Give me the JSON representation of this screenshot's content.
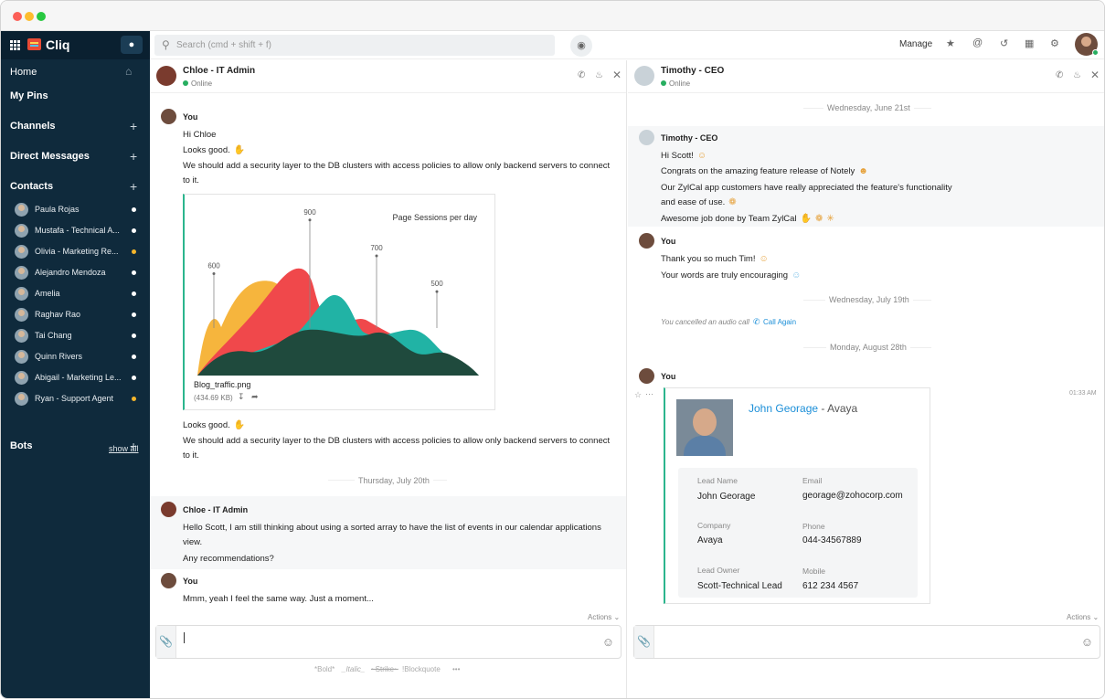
{
  "app": {
    "name": "Cliq"
  },
  "sidebar": {
    "home": "Home",
    "pins": "My Pins",
    "channels": "Channels",
    "direct": "Direct Messages",
    "contacts": "Contacts",
    "bots": "Bots",
    "show_all": "show all",
    "contact_list": [
      {
        "name": "Paula Rojas",
        "status_color": "#ffffff"
      },
      {
        "name": "Mustafa - Technical A...",
        "status_color": "#ffffff"
      },
      {
        "name": "Olivia - Marketing Re...",
        "status_color": "#f5b62b"
      },
      {
        "name": "Alejandro Mendoza",
        "status_color": "#ffffff"
      },
      {
        "name": "Amelia",
        "status_color": "#ffffff"
      },
      {
        "name": "Raghav Rao",
        "status_color": "#ffffff"
      },
      {
        "name": "Tai Chang",
        "status_color": "#ffffff"
      },
      {
        "name": "Quinn Rivers",
        "status_color": "#ffffff"
      },
      {
        "name": "Abigail - Marketing Le...",
        "status_color": "#ffffff"
      },
      {
        "name": "Ryan - Support Agent",
        "status_color": "#f5b62b"
      }
    ]
  },
  "topbar": {
    "search_placeholder": "Search (cmd + shift + f)",
    "manage": "Manage"
  },
  "left_chat": {
    "title": "Chloe - IT Admin",
    "status": "Online",
    "you": "You",
    "m1": "Hi Chloe",
    "m2": "Looks good.",
    "m3a": "We should add a security layer to the DB clusters with access policies to allow only backend servers to connect",
    "m3b": "to it.",
    "attachment": {
      "filename": "Blog_traffic.png",
      "size": "(434.69 KB)"
    },
    "m4": "Looks good.",
    "m5a": "We should add a security layer to the DB clusters with access policies to allow only backend servers to connect",
    "m5b": "to it.",
    "date1": "Thursday, July 20th",
    "chloe": "Chloe - IT Admin",
    "c1a": "Hello Scott, I am still thinking about using a sorted array to have the list of events in our calendar applications",
    "c1b": "view.",
    "c2": "Any recommendations?",
    "you2": "You",
    "y1": "Mmm, yeah I feel the same way. Just a moment...",
    "actions": "Actions",
    "format": {
      "bold": "*Bold*",
      "italic": "_Italic_",
      "strike": "~Strike~",
      "quote": "!Blockquote",
      "more": "•••"
    }
  },
  "chart_data": {
    "type": "area",
    "title": "Page Sessions per day",
    "annotations": [
      {
        "label": "600",
        "value": 600
      },
      {
        "label": "900",
        "value": 900
      },
      {
        "label": "700",
        "value": 700
      },
      {
        "label": "500",
        "value": 500
      }
    ],
    "series_colors": [
      "#f6b53d",
      "#f0484b",
      "#21b3a5",
      "#1f4a3d"
    ]
  },
  "right_chat": {
    "title": "Timothy - CEO",
    "status": "Online",
    "date1": "Wednesday, June 21st",
    "timothy": "Timothy - CEO",
    "t1": "Hi Scott!",
    "t2": "Congrats on the amazing feature release of Notely",
    "t3a": "Our ZylCal app customers have really appreciated the feature's functionality",
    "t3b": "and ease of use.",
    "t4": "Awesome job done by Team ZylCal",
    "you": "You",
    "y1": "Thank you so much Tim!",
    "y2": "Your words are truly encouraging",
    "date2": "Wednesday, July 19th",
    "call_cancel": "You cancelled an audio call",
    "call_again": "Call Again",
    "date3": "Monday, August 28th",
    "you2": "You",
    "time": "01:33 AM",
    "card": {
      "name": "John Georage",
      "company_suffix": "- Avaya",
      "lead_name_label": "Lead Name",
      "lead_name": "John Georage",
      "email_label": "Email",
      "email": "georage@zohocorp.com",
      "company_label": "Company",
      "company": "Avaya",
      "phone_label": "Phone",
      "phone": "044-34567889",
      "owner_label": "Lead Owner",
      "owner": "Scott-Technical Lead",
      "mobile_label": "Mobile",
      "mobile": "612 234 4567"
    },
    "actions": "Actions"
  },
  "icons": [
    "grid-icon",
    "bell-icon",
    "home-icon",
    "plus-icon",
    "search-icon",
    "bot-icon",
    "star-icon",
    "mention-icon",
    "history-icon",
    "calendar-icon",
    "gear-icon",
    "phone-icon",
    "close-icon",
    "attach-icon",
    "smile-icon",
    "download-icon",
    "share-icon"
  ]
}
